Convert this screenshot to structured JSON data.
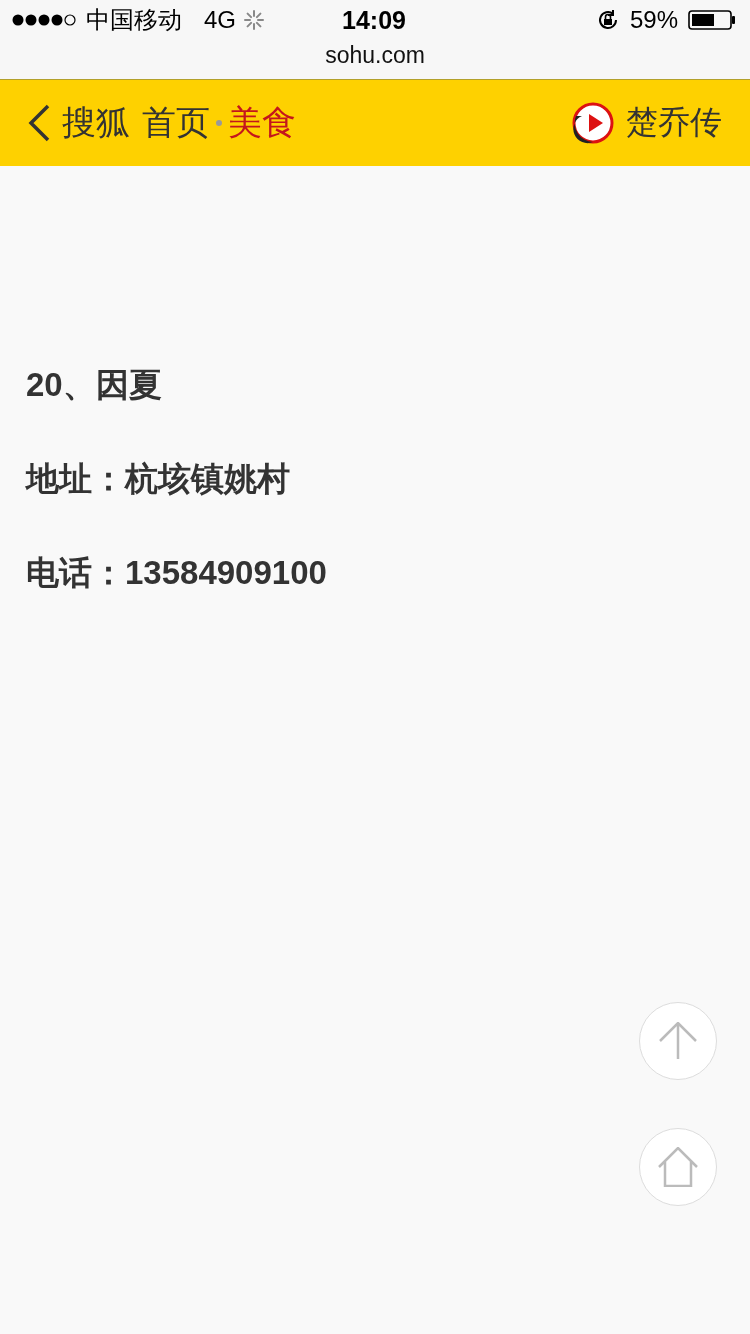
{
  "status_bar": {
    "carrier": "中国移动",
    "network": "4G",
    "time": "14:09",
    "battery": "59%"
  },
  "address_bar": {
    "url": "sohu.com"
  },
  "header": {
    "site": "搜狐",
    "home": "首页",
    "channel": "美食",
    "promo": "楚乔传"
  },
  "article": {
    "paragraphs": [
      "20、因夏",
      "地址：杭垓镇姚村",
      "电话：13584909100"
    ]
  }
}
